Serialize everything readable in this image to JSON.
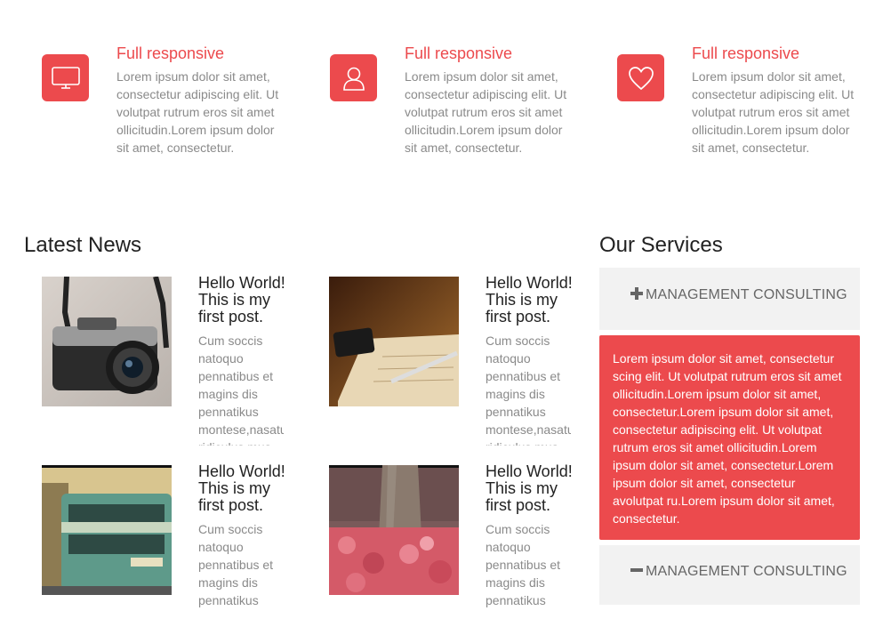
{
  "features": [
    {
      "icon": "monitor-icon",
      "title": "Full responsive",
      "text": "Lorem ipsum dolor sit amet, consectetur adipiscing elit. Ut volutpat rutrum eros sit amet ollicitudin.Lorem ipsum dolor sit amet, consectetur."
    },
    {
      "icon": "user-icon",
      "title": "Full responsive",
      "text": "Lorem ipsum dolor sit amet, consectetur adipiscing elit. Ut volutpat rutrum eros sit amet ollicitudin.Lorem ipsum dolor sit amet, consectetur."
    },
    {
      "icon": "heart-icon",
      "title": "Full responsive",
      "text": "Lorem ipsum dolor sit amet, consectetur adipiscing elit. Ut volutpat rutrum eros sit amet ollicitudin.Lorem ipsum dolor sit amet, consectetur."
    }
  ],
  "news": {
    "title": "Latest News",
    "posts": [
      {
        "image": "camera",
        "title": "Hello World! This is my first post.",
        "text": "Cum soccis natoquo pennatibus et magins dis pennatikus montese,nasatur ridiculus mus"
      },
      {
        "image": "notebook-desk",
        "title": "Hello World! This is my first post.",
        "text": "Cum soccis natoquo pennatibus et magins dis pennatikus montese,nasatur ridiculus mus"
      },
      {
        "image": "tram-street",
        "title": "Hello World! This is my first post.",
        "text": "Cum soccis natoquo pennatibus et magins dis pennatikus"
      },
      {
        "image": "tree-flowers",
        "title": "Hello World! This is my first post.",
        "text": "Cum soccis natoquo pennatibus et magins dis pennatikus"
      }
    ]
  },
  "services": {
    "title": "Our Services",
    "items": [
      {
        "icon": "plus-icon",
        "label": "MANAGEMENT CONSULTING"
      },
      {
        "icon": "minus-icon",
        "label": "MANAGEMENT CONSULTING"
      }
    ],
    "expanded_text": "Lorem ipsum dolor sit amet, consectetur scing elit. Ut volutpat rutrum eros sit amet ollicitudin.Lorem ipsum dolor sit amet, consectetur.Lorem ipsum dolor sit amet, consectetur adipiscing elit. Ut volutpat rutrum eros sit amet ollicitudin.Lorem ipsum dolor sit amet, consectetur.Lorem ipsum dolor sit amet, consectetur avolutpat ru.Lorem ipsum dolor sit amet, consectetur."
  },
  "colors": {
    "accent": "#ec4a4d",
    "panel": "#f2f2f2",
    "body_text": "#8a8a8a",
    "heading": "#222222"
  }
}
